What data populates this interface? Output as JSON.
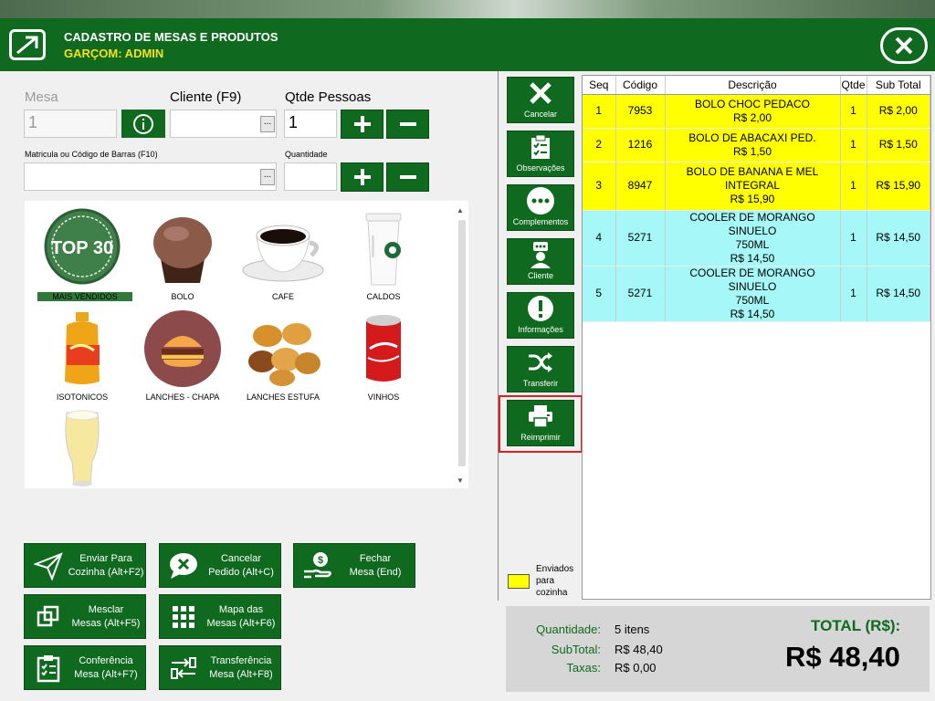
{
  "header": {
    "title": "CADASTRO DE MESAS E PRODUTOS",
    "user": "GARÇOM: ADMIN"
  },
  "form": {
    "mesa_label": "Mesa",
    "mesa_value": "1",
    "cliente_label": "Cliente (F9)",
    "cliente_value": "",
    "pessoas_label": "Qtde Pessoas",
    "pessoas_value": "1",
    "matricula_label": "Matricula ou Código de Barras (F10)",
    "matricula_value": "",
    "quantidade_label": "Quantidade",
    "quantidade_value": "",
    "dots": "..."
  },
  "categories": [
    {
      "name": "MAIS VENDIDOS",
      "badge": "TOP 30"
    },
    {
      "name": "BOLO"
    },
    {
      "name": "CAFE"
    },
    {
      "name": "CALDOS"
    },
    {
      "name": "ISOTONICOS"
    },
    {
      "name": "LANCHES - CHAPA"
    },
    {
      "name": "LANCHES ESTUFA"
    },
    {
      "name": "VINHOS"
    },
    {
      "name": ""
    }
  ],
  "actions": [
    {
      "label": "Enviar Para\nCozinha (Alt+F2)",
      "icon": "paper-plane-icon"
    },
    {
      "label": "Cancelar\nPedido (Alt+C)",
      "icon": "cancel-chat-icon"
    },
    {
      "label": "Fechar\nMesa (End)",
      "icon": "money-hand-icon"
    },
    {
      "label": "Mesclar\nMesas (Alt+F5)",
      "icon": "merge-icon"
    },
    {
      "label": "Mapa das\nMesas (Alt+F6)",
      "icon": "grid-icon"
    },
    {
      "label": "Conferência\nMesa (Alt+F7)",
      "icon": "clipboard-icon"
    },
    {
      "label": "Transferência\nMesa (Alt+F8)",
      "icon": "transfer-icon"
    }
  ],
  "side_buttons": [
    {
      "label": "Cancelar",
      "icon": "x-icon"
    },
    {
      "label": "Observações",
      "icon": "checklist-icon"
    },
    {
      "label": "Complementos",
      "icon": "more-icon"
    },
    {
      "label": "Cliente",
      "icon": "person-icon"
    },
    {
      "label": "Informações",
      "icon": "exclamation-icon"
    },
    {
      "label": "Transferir",
      "icon": "shuffle-icon"
    },
    {
      "label": "Reimprimir",
      "icon": "printer-icon"
    }
  ],
  "table": {
    "headers": [
      "Seq",
      "Código",
      "Descrição",
      "Qtde",
      "Sub Total"
    ],
    "rows": [
      {
        "seq": "1",
        "codigo": "7953",
        "desc1": "BOLO CHOC PEDACO",
        "desc2": "",
        "price": "R$ 2,00",
        "qtde": "1",
        "subtotal": "R$ 2,00",
        "status": "sent"
      },
      {
        "seq": "2",
        "codigo": "1216",
        "desc1": "BOLO DE ABACAXI PED.",
        "desc2": "",
        "price": "R$ 1,50",
        "qtde": "1",
        "subtotal": "R$ 1,50",
        "status": "sent"
      },
      {
        "seq": "3",
        "codigo": "8947",
        "desc1": "BOLO DE BANANA E MEL",
        "desc2": "INTEGRAL",
        "price": "R$ 15,90",
        "qtde": "1",
        "subtotal": "R$ 15,90",
        "status": "sent"
      },
      {
        "seq": "4",
        "codigo": "5271",
        "desc1": "COOLER DE MORANGO SINUELO",
        "desc2": "750ML",
        "price": "R$ 14,50",
        "qtde": "1",
        "subtotal": "R$ 14,50",
        "status": "notsent"
      },
      {
        "seq": "5",
        "codigo": "5271",
        "desc1": "COOLER DE MORANGO SINUELO",
        "desc2": "750ML",
        "price": "R$ 14,50",
        "qtde": "1",
        "subtotal": "R$ 14,50",
        "status": "notsent"
      }
    ]
  },
  "legend": {
    "label": "Enviados para cozinha",
    "color": "#ffff00"
  },
  "summary": {
    "quantidade_label": "Quantidade:",
    "quantidade_value": "5 itens",
    "subtotal_label": "SubTotal:",
    "subtotal_value": "R$ 48,40",
    "taxas_label": "Taxas:",
    "taxas_value": "R$ 0,00",
    "total_label": "TOTAL (R$):",
    "total_value": "R$ 48,40"
  },
  "colors": {
    "brand": "#0f6a1f",
    "accent": "#f3e21a",
    "sent": "#ffff00",
    "pending": "#a6f7f7",
    "highlight": "#e02020"
  }
}
